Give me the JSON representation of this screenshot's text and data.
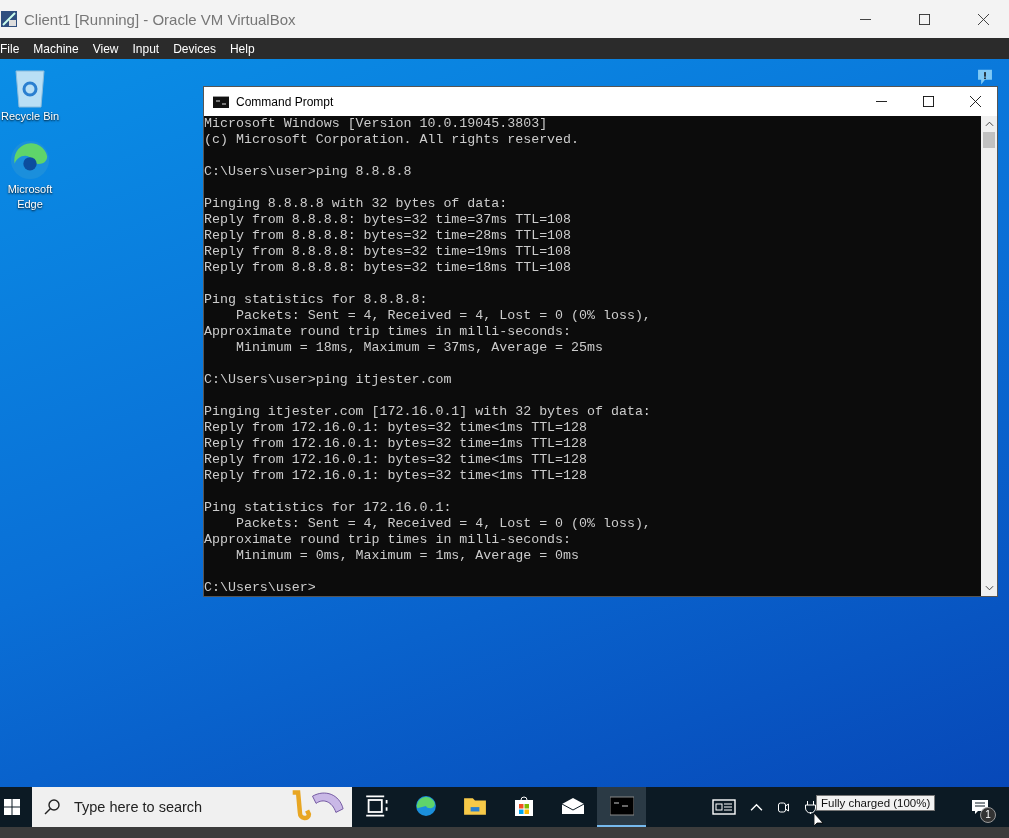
{
  "window": {
    "title": "Client1 [Running] - Oracle VM VirtualBox"
  },
  "menu": [
    "File",
    "Machine",
    "View",
    "Input",
    "Devices",
    "Help"
  ],
  "desktop_icons": [
    {
      "label": "Recycle Bin",
      "kind": "bin"
    },
    {
      "label": "Microsoft Edge",
      "kind": "edge"
    }
  ],
  "console": {
    "title": "Command Prompt",
    "blocks": [
      [
        "Microsoft Windows [Version 10.0.19045.3803]",
        "(c) Microsoft Corporation. All rights reserved."
      ],
      [
        "C:\\Users\\user>ping 8.8.8.8"
      ],
      [
        "Pinging 8.8.8.8 with 32 bytes of data:",
        "Reply from 8.8.8.8: bytes=32 time=37ms TTL=108",
        "Reply from 8.8.8.8: bytes=32 time=28ms TTL=108",
        "Reply from 8.8.8.8: bytes=32 time=19ms TTL=108",
        "Reply from 8.8.8.8: bytes=32 time=18ms TTL=108"
      ],
      [
        "Ping statistics for 8.8.8.8:",
        "    Packets: Sent = 4, Received = 4, Lost = 0 (0% loss),",
        "Approximate round trip times in milli-seconds:",
        "    Minimum = 18ms, Maximum = 37ms, Average = 25ms"
      ],
      [
        "C:\\Users\\user>ping itjester.com"
      ],
      [
        "Pinging itjester.com [172.16.0.1] with 32 bytes of data:",
        "Reply from 172.16.0.1: bytes=32 time<1ms TTL=128",
        "Reply from 172.16.0.1: bytes=32 time=1ms TTL=128",
        "Reply from 172.16.0.1: bytes=32 time<1ms TTL=128",
        "Reply from 172.16.0.1: bytes=32 time<1ms TTL=128"
      ],
      [
        "Ping statistics for 172.16.0.1:",
        "    Packets: Sent = 4, Received = 4, Lost = 0 (0% loss),",
        "Approximate round trip times in milli-seconds:",
        "    Minimum = 0ms, Maximum = 1ms, Average = 0ms"
      ],
      [
        "C:\\Users\\user>"
      ]
    ]
  },
  "taskbar": {
    "search": {
      "placeholder": "Type here to search"
    },
    "apps": [
      {
        "kind": "taskview",
        "selected": false
      },
      {
        "kind": "edge",
        "selected": false
      },
      {
        "kind": "folder",
        "selected": false
      },
      {
        "kind": "store",
        "selected": false
      },
      {
        "kind": "mail",
        "selected": false
      },
      {
        "kind": "cmd",
        "selected": true
      }
    ],
    "tooltip": "Fully charged (100%)",
    "notification_count": "1"
  }
}
